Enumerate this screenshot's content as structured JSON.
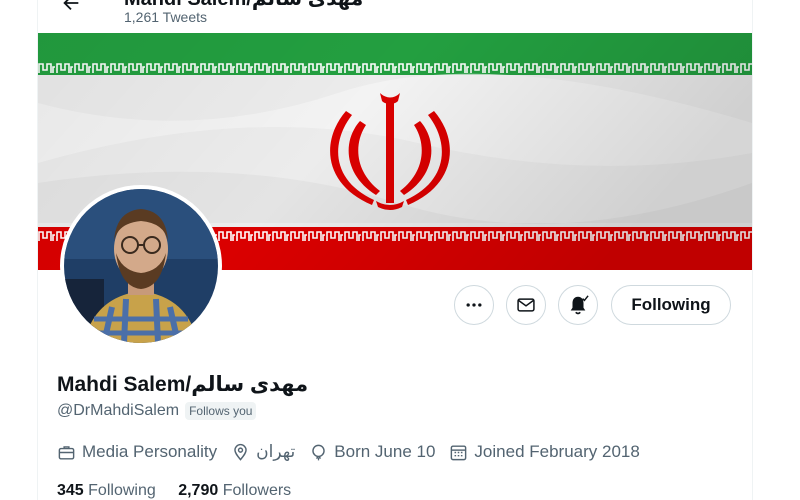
{
  "header": {
    "name": "Mahdi Salem/مهدی سالم",
    "tweet_count": "1,261 Tweets"
  },
  "profile": {
    "display_name": "Mahdi Salem/مهدی سالم",
    "handle": "@DrMahdiSalem",
    "follows_you": "Follows you",
    "category": "Media Personality",
    "location": "تهران",
    "birthday": "Born June 10",
    "joined": "Joined February 2018"
  },
  "actions": {
    "follow_label": "Following",
    "icons": [
      "more-icon",
      "mail-icon",
      "bell-subscribed-icon"
    ]
  },
  "stats": {
    "following_count": "345",
    "following_label": "Following",
    "followers_count": "2,790",
    "followers_label": "Followers"
  },
  "colors": {
    "flag_green": "#239f40",
    "flag_red": "#da0000",
    "text_primary": "#0f1419",
    "text_secondary": "#536471",
    "border": "#cfd9de"
  }
}
